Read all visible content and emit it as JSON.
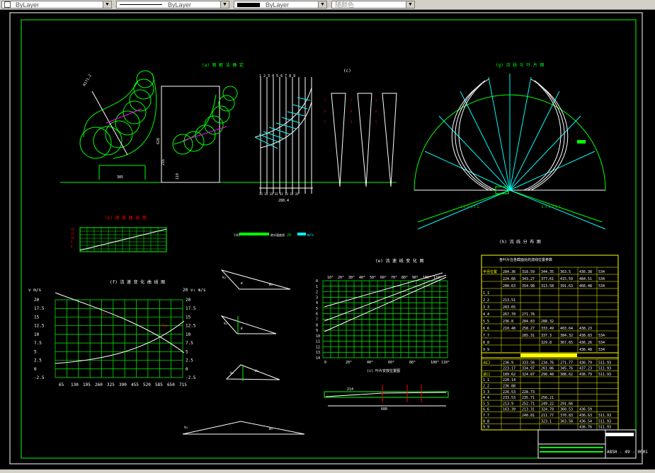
{
  "toolbar": {
    "layer_combo": "ByLayer",
    "linetype_combo": "ByLayer",
    "lineweight_combo": "ByLayer",
    "color_combo": "随颜色"
  },
  "drawing": {
    "fig_a_title": "(a) 图 解 法 确 定",
    "fig_b_title": "(b) 速 度 曲 线 图",
    "fig_c_title": "(c)",
    "fig_d_title": "(d)",
    "fig_d_legend_1": "绝对速度线",
    "fig_d_legend_2": "20",
    "fig_d_legend_3": "m/s",
    "fig_e_title": "(e) 流 速 线 变 化 图",
    "fig_f_title": "(f) 流 速 变 化 曲 线 图",
    "fig_g_title": "(g) 流 线 与 叶 片 图",
    "fig_h_title": "(h) 流 线 分 布 图",
    "fig_i_title": "(i) 叶片安放位置图",
    "dim_385": "385",
    "dim_628": "628",
    "dim_216": "216",
    "dim_119": "119",
    "dim_2884": "288.4",
    "dim_680": "680",
    "dim_214": "214",
    "axis_v_left": "v m/s",
    "axis_v_right": "20 v₁ m/s",
    "x_ticks": [
      "65",
      "130",
      "195",
      "260",
      "325",
      "390",
      "455",
      "520",
      "585",
      "650",
      "715"
    ],
    "y_ticks": [
      "20",
      "17.5",
      "15",
      "12.5",
      "10",
      "7.5",
      "5",
      "2.5",
      "0",
      "-2.5"
    ],
    "e_top_ticks": [
      "10°",
      "20°",
      "30°",
      "40°",
      "50°",
      "60°",
      "70°",
      "80°",
      "90°",
      "100°",
      "110°"
    ],
    "e_bottom_ticks": [
      "0",
      "10°",
      "20°",
      "30°",
      "40°",
      "50°",
      "60°",
      "70°",
      "80°",
      "90°",
      "100°",
      "110°"
    ],
    "table_title": "各叶片在各截面处的流线位置参数",
    "table_rows": [
      [
        "半径位置",
        "284.36",
        "318.59",
        "344.35",
        "363.5",
        "436.38",
        "534"
      ],
      [
        "",
        "224.66",
        "343.27",
        "377.61",
        "415.59",
        "484.51",
        "534"
      ],
      [
        "",
        "200.63",
        "354.98",
        "313.58",
        "391.63",
        "466.48",
        "534"
      ],
      [
        "1_1",
        "",
        "",
        "",
        "",
        "",
        ""
      ],
      [
        "2_2",
        "213.51",
        "",
        "",
        "",
        "",
        ""
      ],
      [
        "3_3",
        "283.65",
        "",
        "",
        "",
        "",
        ""
      ],
      [
        "4_4",
        "267.70",
        "271.76",
        "",
        "",
        "",
        ""
      ],
      [
        "5_5",
        "236.8",
        "284.83",
        "288.32",
        "",
        "",
        ""
      ],
      [
        "6_6",
        "210.48",
        "258.27",
        "333.49",
        "403.64",
        "438.23",
        ""
      ],
      [
        "7_7",
        "",
        "285.31",
        "337.3",
        "384.32",
        "438.83",
        "534"
      ],
      [
        "8_8",
        "",
        "",
        "329.8",
        "367.65",
        "436.26",
        "534"
      ],
      [
        "9_9",
        "",
        "",
        "",
        "",
        "436.48",
        "534"
      ]
    ],
    "table2_rows": [
      [
        "出口",
        "236.9",
        "333.56",
        "234.76",
        "271.77",
        "436.79",
        "511.93"
      ],
      [
        "",
        "223.17",
        "334.97",
        "261.86",
        "345.76",
        "437.23",
        "511.93"
      ],
      [
        "进口",
        "189.62",
        "324.87",
        "298.48",
        "388.62",
        "436.79",
        "511.93"
      ],
      [
        "1_1",
        "220.14",
        "",
        "",
        "",
        "",
        ""
      ],
      [
        "2_2",
        "236.88",
        "",
        "",
        "",
        "",
        ""
      ],
      [
        "3_3",
        "226.53",
        "228.73",
        "",
        "",
        "",
        ""
      ],
      [
        "4_4",
        "233.53",
        "235.71",
        "256.21",
        "",
        "",
        ""
      ],
      [
        "5_5",
        "213.9",
        "252.71",
        "249.22",
        "291.66",
        "",
        ""
      ],
      [
        "6_6",
        "163.39",
        "213.31",
        "324.78",
        "360.53",
        "436.59",
        ""
      ],
      [
        "7_7",
        "",
        "240.81",
        "211.77",
        "370.83",
        "436.63",
        "511.93"
      ],
      [
        "8_8",
        "",
        "",
        "323.1",
        "363.58",
        "436.54",
        "511.93"
      ],
      [
        "9_9",
        "",
        "",
        "",
        "",
        "436.76",
        "511.93"
      ]
    ],
    "title_block_code": "A8SH - 49 - 0001",
    "small_labels": [
      "α",
      "β",
      "Vu",
      "Wu",
      "Vm",
      "W",
      "V"
    ]
  },
  "colors": {
    "green": "#00ff00",
    "white": "#ffffff",
    "yellow": "#ffff00",
    "cyan": "#00ffff",
    "red": "#ff0000",
    "magenta": "#ff00ff"
  }
}
